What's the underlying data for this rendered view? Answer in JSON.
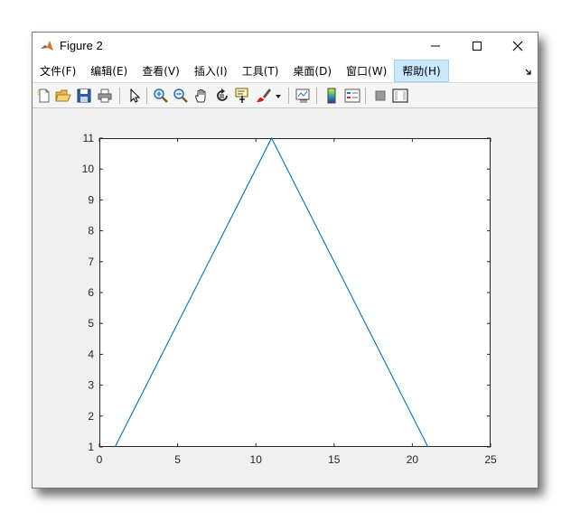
{
  "window": {
    "title": "Figure 2"
  },
  "menu": {
    "items": [
      {
        "label": "文件(F)"
      },
      {
        "label": "编辑(E)"
      },
      {
        "label": "查看(V)"
      },
      {
        "label": "插入(I)"
      },
      {
        "label": "工具(T)"
      },
      {
        "label": "桌面(D)"
      },
      {
        "label": "窗口(W)"
      },
      {
        "label": "帮助(H)",
        "active": true
      }
    ]
  },
  "toolbar": {
    "icons": [
      "new-figure-icon",
      "open-file-icon",
      "save-icon",
      "print-icon",
      "edit-plot-icon",
      "zoom-in-icon",
      "zoom-out-icon",
      "pan-icon",
      "rotate-3d-icon",
      "data-cursor-icon",
      "brush-icon",
      "brush-dropdown-icon",
      "link-plot-icon",
      "colorbar-icon",
      "legend-icon",
      "hide-plot-tools-icon",
      "show-plot-tools-icon"
    ]
  },
  "colors": {
    "line": "#0072bd",
    "axes": "#262626",
    "figure_bg": "#f0f0f0"
  },
  "chart_data": {
    "type": "line",
    "x": [
      1,
      11,
      21
    ],
    "y": [
      1,
      11,
      1
    ],
    "xlim": [
      0,
      25
    ],
    "ylim": [
      1,
      11
    ],
    "xticks": [
      "0",
      "5",
      "10",
      "15",
      "20",
      "25"
    ],
    "yticks": [
      "1",
      "2",
      "3",
      "4",
      "5",
      "6",
      "7",
      "8",
      "9",
      "10",
      "11"
    ],
    "grid": false
  }
}
